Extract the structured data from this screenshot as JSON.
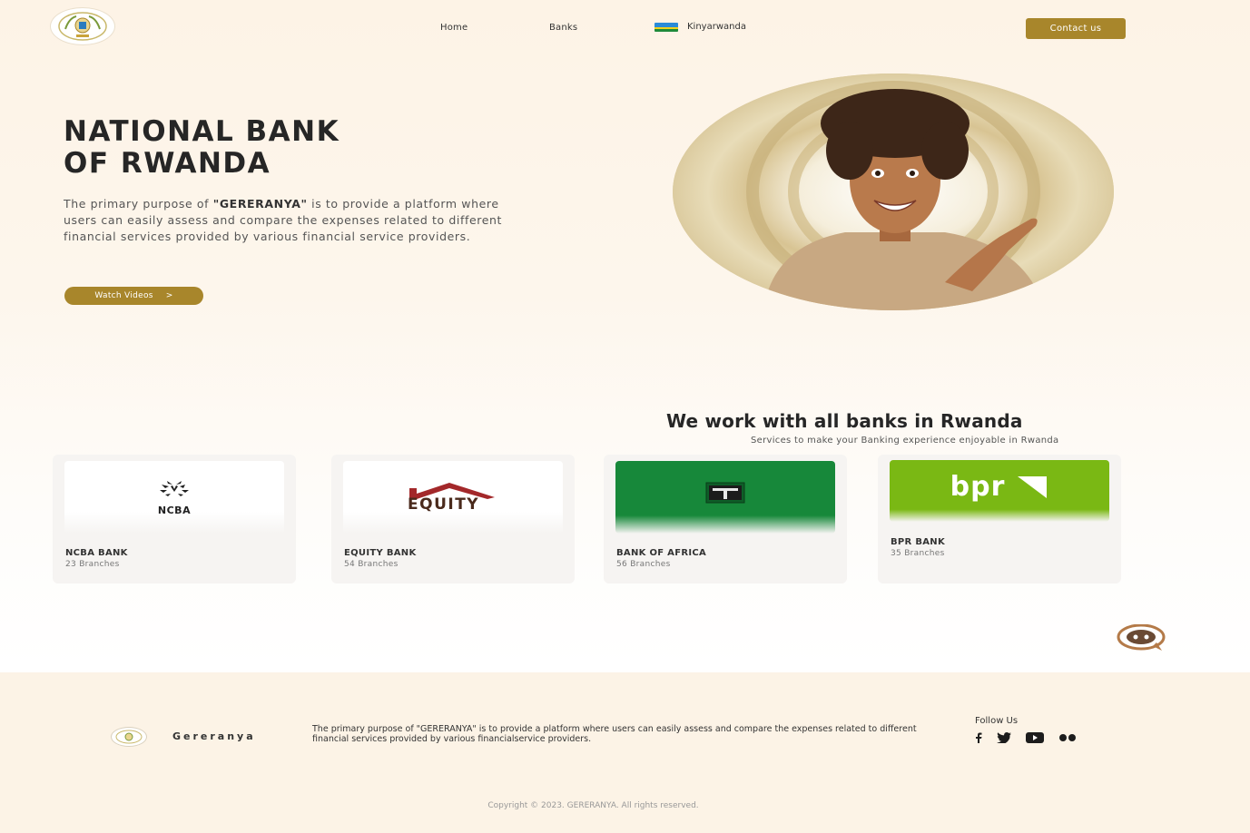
{
  "header": {
    "nav": [
      "Home",
      "Banks",
      "Kinyarwanda"
    ],
    "contact_label": "Contact us"
  },
  "hero": {
    "title_line1": "NATIONAL BANK",
    "title_line2": "OF RWANDA",
    "desc_pre": "The primary purpose of ",
    "desc_brand": "\"GERERANYA\"",
    "desc_post": " is to provide a platform where users can easily assess and compare the expenses related to different financial services provided by various financial service providers.",
    "watch_label": "Watch Videos",
    "watch_arrow": ">"
  },
  "banks_section": {
    "title": "We work with all banks in Rwanda",
    "subtitle": "Services to make your Banking experience  enjoyable in Rwanda",
    "banks": [
      {
        "name": "NCBA BANK",
        "branches": "23 Branches",
        "logo_text": "NCBA"
      },
      {
        "name": "EQUITY BANK",
        "branches": "54 Branches",
        "logo_text": "EQUITY"
      },
      {
        "name": "BANK OF AFRICA",
        "branches": "56 Branches",
        "logo_text": ""
      },
      {
        "name": "BPR BANK",
        "branches": "35 Branches",
        "logo_text": "bpr"
      }
    ]
  },
  "footer": {
    "brand": "Gereranya",
    "desc": "The primary purpose of \"GERERANYA\"  is to provide a platform where users can easily assess and compare the expenses related to different financial services provided by various financialservice providers.",
    "follow_title": "Follow Us",
    "socials": [
      "facebook-icon",
      "twitter-icon",
      "youtube-icon",
      "flickr-icon"
    ],
    "copyright": "Copyright © 2023. GERERANYA. All rights reserved."
  },
  "colors": {
    "accent": "#a8862b",
    "ncba_green": "#1f1f1f",
    "equity_red": "#a3282a",
    "boa_green": "#17883a",
    "bpr_green": "#7ab814"
  }
}
